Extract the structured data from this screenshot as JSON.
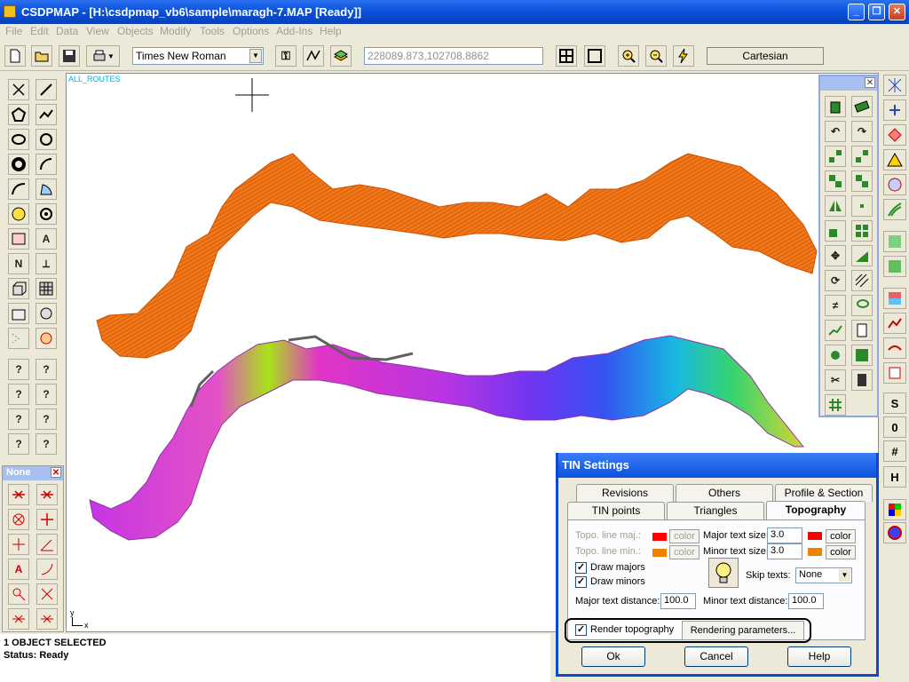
{
  "window": {
    "title": "CSDPMAP - [H:\\csdpmap_vb6\\sample\\maragh-7.MAP [Ready]]"
  },
  "menu": [
    "File",
    "Edit",
    "Data",
    "View",
    "Objects",
    "Modify",
    "Tools",
    "Options",
    "Add-Ins",
    "Help"
  ],
  "toolbar": {
    "font": "Times New Roman",
    "coords": "228089.873,102708.8862",
    "coord_system": "Cartesian"
  },
  "canvas": {
    "layer_label": "ALL_ROUTES",
    "axis_y": "y",
    "axis_x": "x"
  },
  "left_tools": [
    "?",
    "?",
    "?",
    "?",
    "?",
    "?",
    "?",
    "?"
  ],
  "left_tool_letters": [
    "N",
    "A"
  ],
  "none_panel": {
    "title": "None"
  },
  "right_tools": [
    "S",
    "0",
    "H"
  ],
  "status": {
    "line1": "1 OBJECT SELECTED",
    "line2": "Status: Ready"
  },
  "dialog": {
    "title": "TIN Settings",
    "tabs_row1": [
      "Revisions",
      "Others",
      "Profile & Section"
    ],
    "tabs_row2": [
      "TIN points",
      "Triangles",
      "Topography"
    ],
    "topo_major_label": "Topo. line maj.:",
    "topo_minor_label": "Topo. line min.:",
    "color_label": "color",
    "major_text_size_label": "Major text size:",
    "major_text_size": "3.0",
    "minor_text_size_label": "Minor text size:",
    "minor_text_size": "3.0",
    "draw_majors": "Draw majors",
    "draw_minors": "Draw minors",
    "skip_texts_label": "Skip texts:",
    "skip_texts_value": "None",
    "major_text_distance_label": "Major text distance:",
    "major_text_distance": "100.0",
    "minor_text_distance_label": "Minor text distance:",
    "minor_text_distance": "100.0",
    "render_topography": "Render topography",
    "rendering_parameters": "Rendering parameters...",
    "ok": "Ok",
    "cancel": "Cancel",
    "help": "Help",
    "colors": {
      "major": "#ff0000",
      "minor": "#f08000",
      "major_text": "#ff0000",
      "minor_text": "#f08000"
    }
  }
}
